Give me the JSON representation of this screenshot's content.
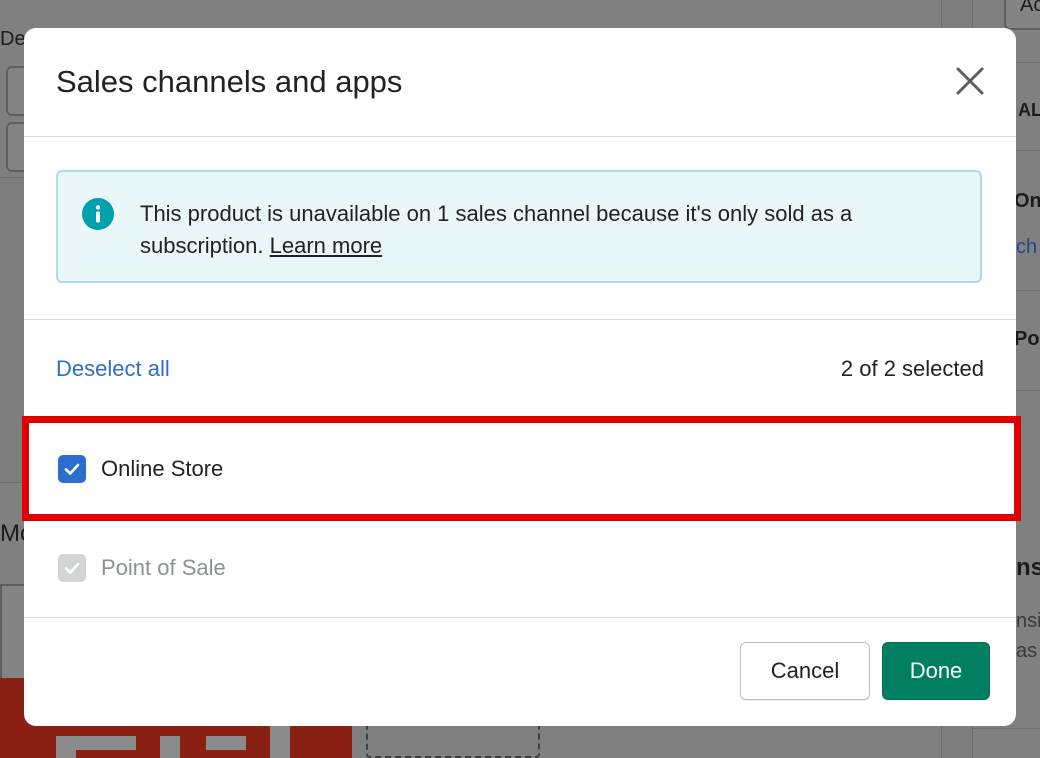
{
  "background": {
    "left_labels": [
      "De",
      "Mo"
    ],
    "right_labels": [
      "Ac",
      "AL",
      "Onl",
      "ch",
      "Poi",
      "ns",
      "nsi",
      "as"
    ]
  },
  "modal": {
    "title": "Sales channels and apps",
    "close_icon": "close-icon",
    "banner": {
      "icon": "info-icon",
      "text": "This product is unavailable on 1 sales channel because it's only sold as a subscription.",
      "link_text": "Learn more"
    },
    "list_header": {
      "deselect_label": "Deselect all",
      "selected_count": "2 of 2 selected"
    },
    "channels": [
      {
        "label": "Online Store",
        "checked": true,
        "disabled": false
      },
      {
        "label": "Point of Sale",
        "checked": true,
        "disabled": true
      }
    ],
    "footer": {
      "cancel_label": "Cancel",
      "done_label": "Done"
    }
  },
  "colors": {
    "accent_blue": "#2c6ecb",
    "primary_green": "#008060",
    "banner_bg": "#e9f7f8",
    "info_teal": "#00a0ac",
    "highlight_red": "#e00000"
  }
}
